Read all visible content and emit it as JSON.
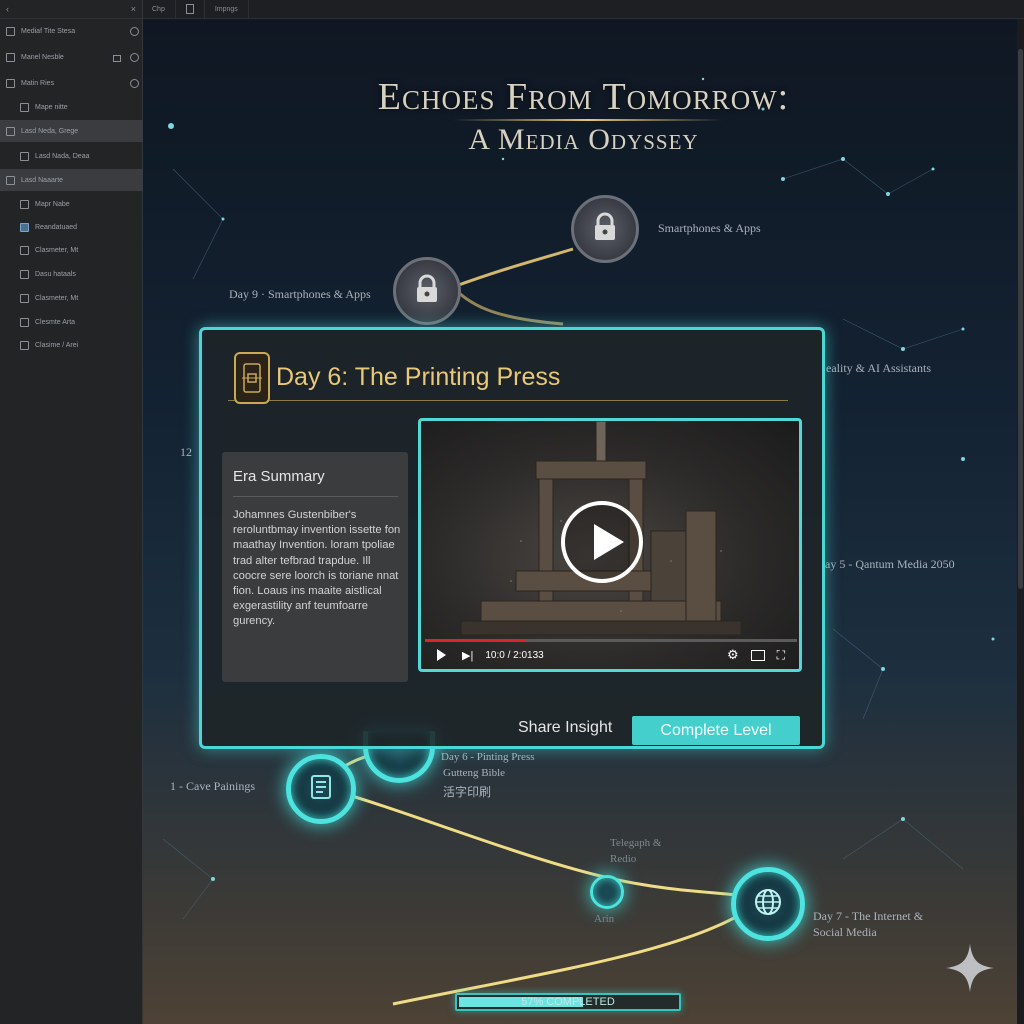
{
  "tabstrip": {
    "tabs": [
      "Chp",
      "",
      "Impngs"
    ]
  },
  "sidebar": {
    "items": [
      {
        "label": "Mediaf Tite Stesa"
      },
      {
        "label": "Manel Nesble"
      },
      {
        "label": "Matin Ries"
      },
      {
        "label": "Mape nitte"
      },
      {
        "label": "Lasd Neda, Grege"
      },
      {
        "label": "Lasd Nada, Deaa"
      },
      {
        "label": "Lasd Naaarte"
      },
      {
        "label": "Mapr Nabe"
      },
      {
        "label": "Reandatuaed"
      },
      {
        "label": "Clasmeter, Mt"
      },
      {
        "label": "Dasu hataals"
      },
      {
        "label": "Clasmeter, Mt"
      },
      {
        "label": "Clesmte Arta"
      },
      {
        "label": "Clasime / Arei"
      }
    ]
  },
  "scene": {
    "title_line1": "Echoes From Tomorrow:",
    "title_line2": "A Media Odyssey",
    "nodes": {
      "smartphones_apps": "Smartphones & Apps",
      "day9": "Day 9 · Smartphones & Apps",
      "ai_assistants": "eality & AI Assistants",
      "quantum": "ay 5 - Qantum Media 2050",
      "num12": "12",
      "cave": "1 - Cave Painings",
      "printing_press_label": "Day 6 - Pinting Press",
      "printing_press_sub": "Gutteng Bible",
      "printing_press_cn": "活字印刷",
      "telegraph": "Telegaph &",
      "telegraph_sub": "Redio",
      "arin": "Arin",
      "day7_line1": "Day 7 - The Internet &",
      "day7_line2": "Social Media"
    },
    "progress": {
      "label": "57% COMPLETED",
      "fraction": 0.57
    }
  },
  "modal": {
    "title": "Day 6: The Printing Press",
    "era_summary": {
      "heading": "Era Summary",
      "body": "Johamnes Gustenbiber's reroluntbmay invention issette fon maathay Invention. loram tpoliae trad alter tefbrad trapdue. Ill coocre sere loorch is toriane nnat fion. Loaus ins maaite aistlical exgerastility anf teumfoarre gurency."
    },
    "video": {
      "time": "10:0 / 2:0133",
      "progress_fraction": 0.27
    },
    "buttons": {
      "share": "Share Insight",
      "complete": "Complete Level"
    }
  },
  "colors": {
    "accent": "#49d8d6",
    "gold": "#e9c878",
    "video_progress": "#d72727"
  }
}
